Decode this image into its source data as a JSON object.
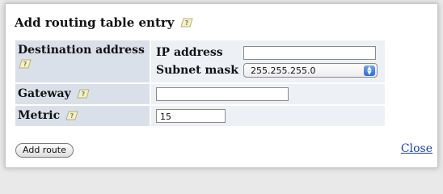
{
  "dialog": {
    "title": "Add routing table entry"
  },
  "form": {
    "destination_label": "Destination address",
    "ip_label": "IP address",
    "ip_value": "",
    "subnet_label": "Subnet mask",
    "subnet_selected": "255.255.255.0",
    "gateway_label": "Gateway",
    "gateway_value": "",
    "metric_label": "Metric",
    "metric_value": "15"
  },
  "actions": {
    "add_route_label": "Add route",
    "close_label": "Close"
  },
  "icons": {
    "help": "help-hint-icon"
  },
  "colors": {
    "label_cell_bg": "#d9e0ea",
    "content_cell_bg": "#edf1f6",
    "link": "#1a3ea8",
    "select_accent": "#2f6ed3"
  }
}
